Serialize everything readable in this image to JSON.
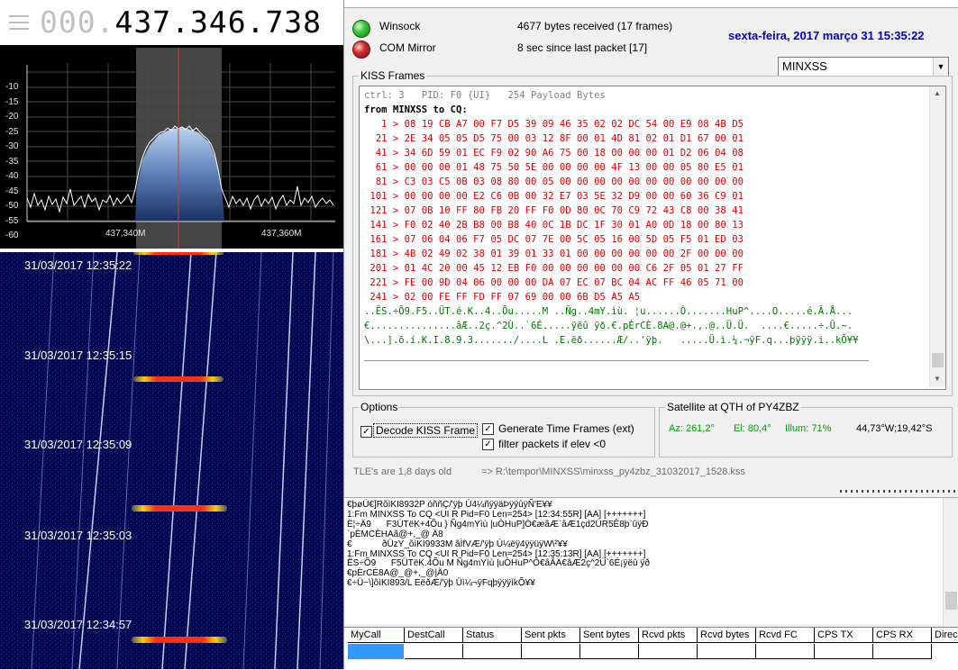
{
  "sdr": {
    "frequency_dim": "000.",
    "frequency_main": "437.346.738",
    "db_labels": [
      "-10",
      "-15",
      "-20",
      "-25",
      "-30",
      "-35",
      "-40",
      "-45",
      "-50",
      "-55",
      "-60"
    ],
    "mhz_labels": [
      "437,340M",
      "437,360M"
    ],
    "timestamps": [
      "31/03/2017 12:35:22",
      "31/03/2017 12:35:15",
      "31/03/2017 12:35:09",
      "31/03/2017 12:35:03",
      "31/03/2017 12:34:57"
    ]
  },
  "status": {
    "winsock_label": "Winsock",
    "com_label": "COM Mirror",
    "bytes_received": "4677 bytes received (17 frames)",
    "since_last": "8 sec since last packet [17]",
    "date": "sexta-feira, 2017 março 31   15:35:22",
    "satellite": "MINXSS"
  },
  "kiss": {
    "title": "KISS Frames",
    "header": "ctrl: 3   PID: F0 {UI}   254 Payload Bytes",
    "from": "from MINXSS to CQ:",
    "hex_lines": [
      "   1 > 08 19 CB A7 00 F7 D5 39 09 46 35 02 02 DC 54 00 E9 08 4B D5",
      "  21 > 2E 34 05 05 D5 75 00 03 12 8F 00 01 4D 81 02 01 D1 67 00 01",
      "  41 > 34 6D 59 01 EC F9 02 90 A6 75 00 18 00 00 00 01 D2 06 04 08",
      "  61 > 00 00 00 01 48 75 50 5E 00 00 00 00 4F 13 00 00 05 80 E5 01",
      "  81 > C3 03 C5 0B 03 08 80 00 05 00 00 00 00 00 00 00 00 00 00 00",
      " 101 > 00 00 00 00 E2 C6 0B 00 32 E7 03 5E 32 D9 00 00 60 36 C9 01",
      " 121 > 07 0B 10 FF 80 FB 20 FF F0 0D 80 0C 70 C9 72 43 C8 00 38 41",
      " 141 > F0 02 40 2B B8 00 B8 40 0C 1B DC 1F 30 01 A0 0D 18 00 80 13",
      " 161 > 07 06 04 06 F7 05 DC 07 7E 00 5C 05 16 00 5D 05 F5 01 ED 03",
      " 181 > 4B 02 49 02 38 01 39 01 33 01 00 00 00 00 00 00 2F 00 00 00",
      " 201 > 01 4C 20 00 45 12 EB F0 00 00 00 00 00 00 C6 2F 05 01 27 FF",
      " 221 > FE 00 9D 04 06 00 00 00 DA 07 EC 07 BC 04 AC FF 46 05 71 00",
      " 241 > 02 00 FE FF FD FF 07 69 00 00 6B D5 A5 A5"
    ],
    "ascii_lines": [
      "..ËS.÷Õ9.F5..ÜT.é.K..4..Õu.....M ..Ñg..4mY.ìù. ¦u......Ò.......HuP^....O.....é.Ã.Å...",
      "€...............âÆ..2ç.^2Ù..`6É.....ÿëû ÿð.€.pÈrCÈ.8A@.@+.,.@..Ü.Ü.  ....€.....÷.Ü.~.",
      "\\...].õ.í.K.I.8.9.3......./....L .E.ëð......Æ/..'ÿþ.   .....Ü.ì.¼.¬ÿF.q...þÿÿÿ.i..kÕ¥¥"
    ]
  },
  "options": {
    "title": "Options",
    "decode": "Decode KISS Frame",
    "gen_time": "Generate Time Frames (ext)",
    "filter": "filter packets if elev <0",
    "check_mark": "✓"
  },
  "satinfo": {
    "title": "Satellite at QTH of PY4ZBZ",
    "az": "Az: 261,2°",
    "el": "El: 80,4°",
    "illum": "Illum: 71%",
    "pos": "44,73°W;19,42°S"
  },
  "tle": "TLE's are 1,8 days old",
  "logfile": "=> R:\\tempor\\MINXSS\\minxss_py4zbz_31032017_1528.kss",
  "terminal": [
    "€þøÜ€]RõìKI8932P óññÇ/'ÿþ Ú4¼ñÿÿäÞÿÿûÿÑ'E¥¥",
    "1:Fm MINXSS To CQ <UI R Pid=F0 Len=254> [12:34:55R] [AA] [+++++++]",
    "Ë¦÷Ä9      F3ÜTëK+4Õu } Ñg4mYìù |uÒHuP]Ò€æâÆ`âÆ1çd2ÜR5Ê8þ`ûÿÐ",
    "`pÈMCÈHAã@+,_@ Ä8",
    "€            ðÜzY_õìKI9933M ãÌfVÆ/'ÿþ Ú¼ëÿ4ÿÿüÿW\\²¥¥",
    "1:Fm MINXSS To CQ <UI R Pid=F0 Len=254> [12:35:13R] [AA] [+++++++]",
    "ËS÷Õ9      F5ÜTëK.4Õu M Ñg4mYìù |uÒHuP^Ò€âÂÄ€âÆ2ç^2Ù`6É¡ÿëû ÿð",
    "€pÈrCÈ8A@_@+,_@|Ä0",
    "€÷Ü~\\]õìKI893/L EëðÆ/'ÿþ Üì¼¬ÿFqþÿÿÿìkÕ¥¥"
  ],
  "grid": {
    "columns": [
      "MyCall",
      "DestCall",
      "Status",
      "Sent pkts",
      "Sent bytes",
      "Rcvd pkts",
      "Rcvd bytes",
      "Rcvd FC",
      "CPS TX",
      "CPS RX",
      "Direc"
    ]
  }
}
